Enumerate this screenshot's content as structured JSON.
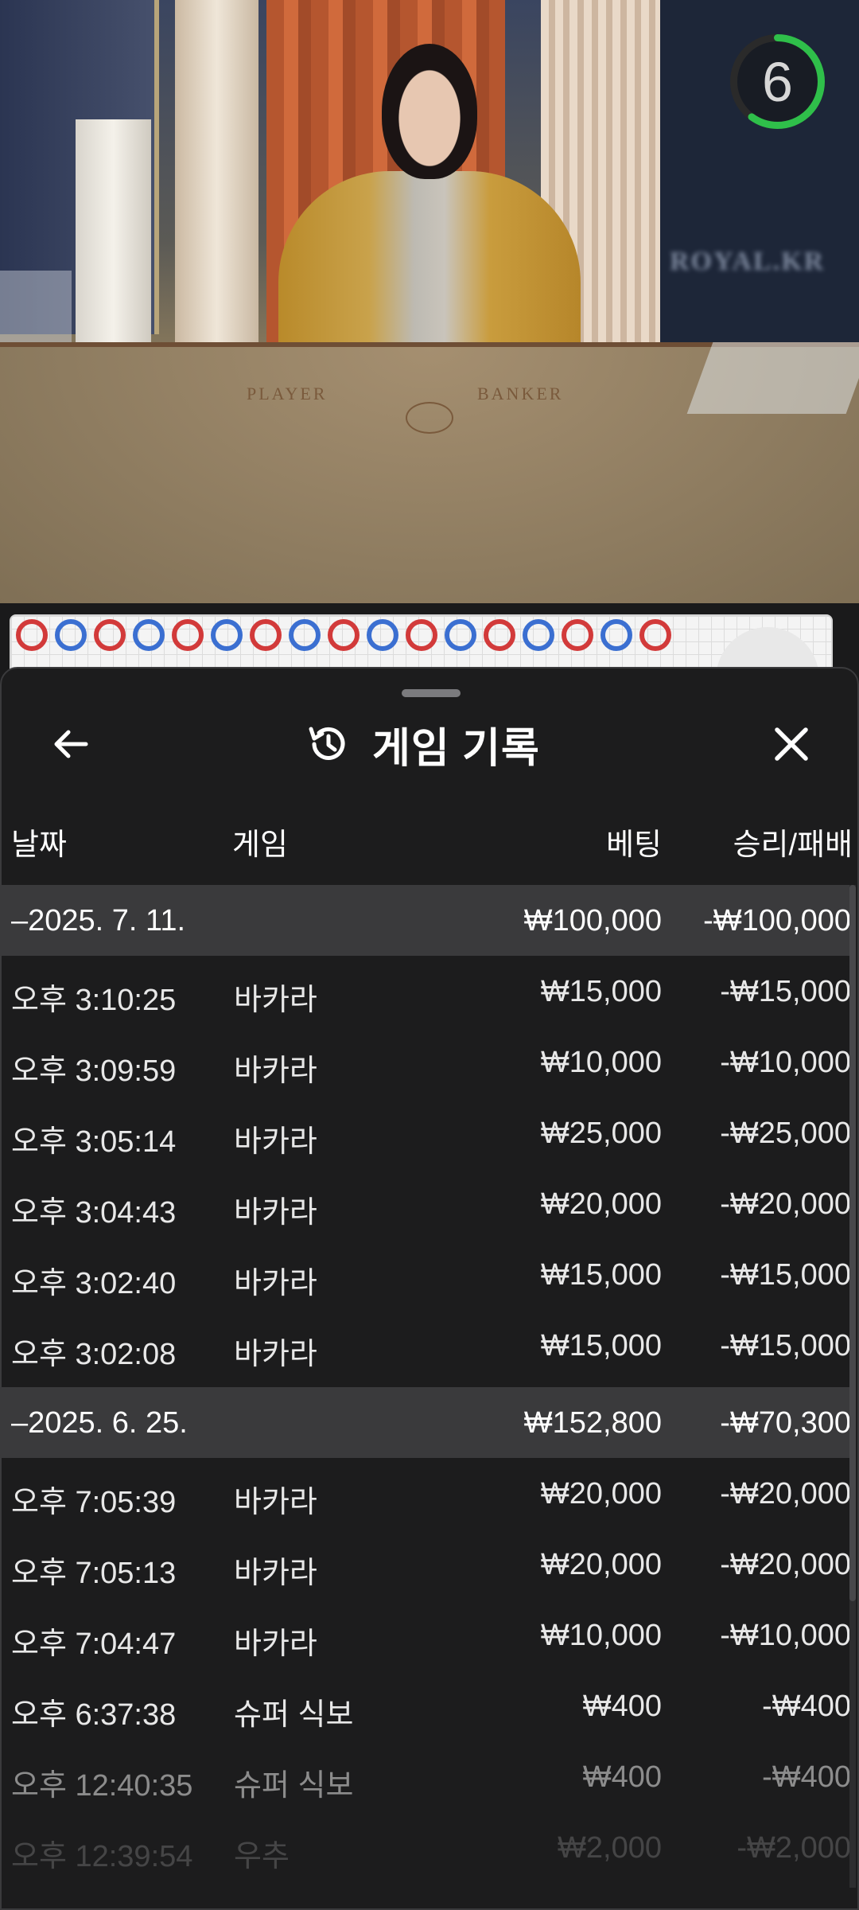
{
  "video": {
    "table_left_label": "PLAYER",
    "table_right_label": "BANKER",
    "watermark": "ROYAL.KR",
    "countdown": "6",
    "countdown_fraction": 0.6
  },
  "roadmap": {
    "beads_top": [
      "b",
      "p",
      "b",
      "p",
      "b",
      "p",
      "b",
      "p",
      "b",
      "p",
      "b",
      "p",
      "b",
      "p",
      "b",
      "p",
      "b"
    ]
  },
  "sheet": {
    "title": "게임 기록",
    "columns": {
      "date": "날짜",
      "game": "게임",
      "bet": "베팅",
      "result": "승리/패배"
    },
    "groups": [
      {
        "date": "–2025. 7. 11.",
        "bet_total": "₩100,000",
        "result_total": "-₩100,000",
        "rows": [
          {
            "time": "오후 3:10:25",
            "game": "바카라",
            "bet": "₩15,000",
            "result": "-₩15,000"
          },
          {
            "time": "오후 3:09:59",
            "game": "바카라",
            "bet": "₩10,000",
            "result": "-₩10,000"
          },
          {
            "time": "오후 3:05:14",
            "game": "바카라",
            "bet": "₩25,000",
            "result": "-₩25,000"
          },
          {
            "time": "오후 3:04:43",
            "game": "바카라",
            "bet": "₩20,000",
            "result": "-₩20,000"
          },
          {
            "time": "오후 3:02:40",
            "game": "바카라",
            "bet": "₩15,000",
            "result": "-₩15,000"
          },
          {
            "time": "오후 3:02:08",
            "game": "바카라",
            "bet": "₩15,000",
            "result": "-₩15,000"
          }
        ]
      },
      {
        "date": "–2025. 6. 25.",
        "bet_total": "₩152,800",
        "result_total": "-₩70,300",
        "rows": [
          {
            "time": "오후 7:05:39",
            "game": "바카라",
            "bet": "₩20,000",
            "result": "-₩20,000"
          },
          {
            "time": "오후 7:05:13",
            "game": "바카라",
            "bet": "₩20,000",
            "result": "-₩20,000"
          },
          {
            "time": "오후 7:04:47",
            "game": "바카라",
            "bet": "₩10,000",
            "result": "-₩10,000"
          },
          {
            "time": "오후 6:37:38",
            "game": "슈퍼 식보",
            "bet": "₩400",
            "result": "-₩400"
          },
          {
            "time": "오후 12:40:35",
            "game": "슈퍼 식보",
            "bet": "₩400",
            "result": "-₩400"
          },
          {
            "time": "오후 12:39:54",
            "game": "우추",
            "bet": "₩2,000",
            "result": "-₩2,000"
          }
        ]
      }
    ]
  },
  "colors": {
    "sheet_bg": "#1c1c1d",
    "group_row_bg": "#3a3a3c",
    "player_blue": "#3b6fd1",
    "banker_red": "#d23a3a",
    "timer_green": "#2fbf4a"
  }
}
